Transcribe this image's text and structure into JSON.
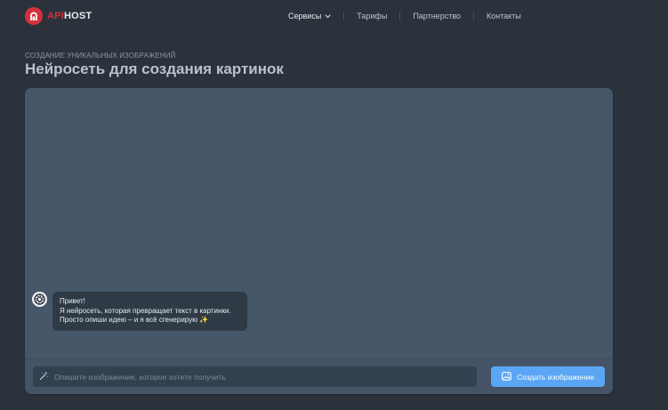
{
  "header": {
    "logo_api": "API",
    "logo_host": "HOST",
    "nav": [
      {
        "label": "Сервисы",
        "has_dropdown": true,
        "active": true
      },
      {
        "label": "Тарифы"
      },
      {
        "label": "Партнерство"
      },
      {
        "label": "Контакты"
      }
    ]
  },
  "page": {
    "subtitle": "СОЗДАНИЕ УНИКАЛЬНЫХ ИЗОБРАЖЕНИЙ",
    "title": "Нейросеть для создания картинок"
  },
  "chat": {
    "message_lines": [
      "Привет!",
      "Я нейросеть, которая превращает текст в картинки.",
      "Просто опиши идею – и я всё сгенерирую"
    ],
    "sparkle": "✨"
  },
  "composer": {
    "placeholder": "Опишите изображение, которое хотите получить",
    "value": "",
    "submit_label": "Создать изображение"
  },
  "icons": {
    "logo": "apihost-logo-icon",
    "dropdown": "chevron-down-icon",
    "bot": "aperture-icon",
    "input": "magic-wand-icon",
    "submit": "image-icon"
  },
  "colors": {
    "background": "#2b323b",
    "panel": "#465769",
    "brand_red": "#d5313b",
    "accent_blue": "#5aa6f4",
    "bubble": "#2f3a47"
  }
}
